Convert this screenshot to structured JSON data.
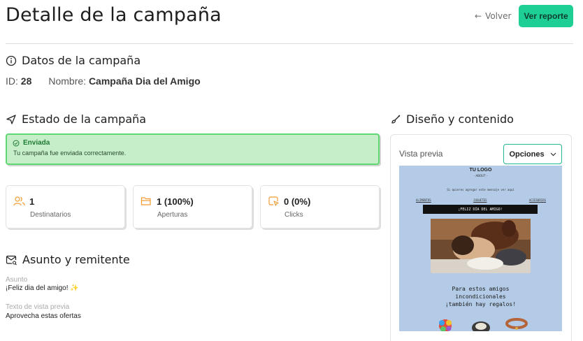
{
  "header": {
    "title": "Detalle de la campaña",
    "back_label": "Volver",
    "report_label": "Ver reporte"
  },
  "campaign_info": {
    "section_title": "Datos de la campaña",
    "id_label": "ID:",
    "id_value": "28",
    "name_label": "Nombre:",
    "name_value": "Campaña Dia del Amigo"
  },
  "status": {
    "section_title": "Estado de la campaña",
    "state_label": "Enviada",
    "state_message": "Tu campaña fue enviada correctamente."
  },
  "stats": [
    {
      "value": "1",
      "label": "Destinatarios",
      "icon": "users-icon"
    },
    {
      "value": "1 (100%)",
      "label": "Aperturas",
      "icon": "folder-open-icon"
    },
    {
      "value": "0 (0%)",
      "label": "Clicks",
      "icon": "click-icon"
    }
  ],
  "subject_sender": {
    "section_title": "Asunto y remitente",
    "subject_label": "Asunto",
    "subject_value": "¡Feliz dia del amigo!",
    "subject_emoji": "✨",
    "preview_text_label": "Texto de vista previa",
    "preview_text_value": "Aprovecha estas ofertas"
  },
  "design": {
    "section_title": "Diseño y contenido",
    "preview_label": "Vista previa",
    "options_label": "Opciones",
    "email": {
      "logo_title": "TU LOGO",
      "logo_subtitle": "- ABOUT -",
      "top_note": "Si quieres agregar este mensaje ver aquí",
      "links": [
        "ALIMENTOS",
        "JUGUETES",
        "ACCESORIOS"
      ],
      "banner_text": "¡FELIZ DÍA DEL AMIGO!",
      "copy_lines": [
        "Para estos amigos",
        "incondicionales",
        "¡también hay regalos!"
      ]
    }
  },
  "colors": {
    "accent": "#1ecf95",
    "status_bg": "#c6efc9",
    "status_border": "#5fd773",
    "icon_orange": "#f39a2e"
  }
}
